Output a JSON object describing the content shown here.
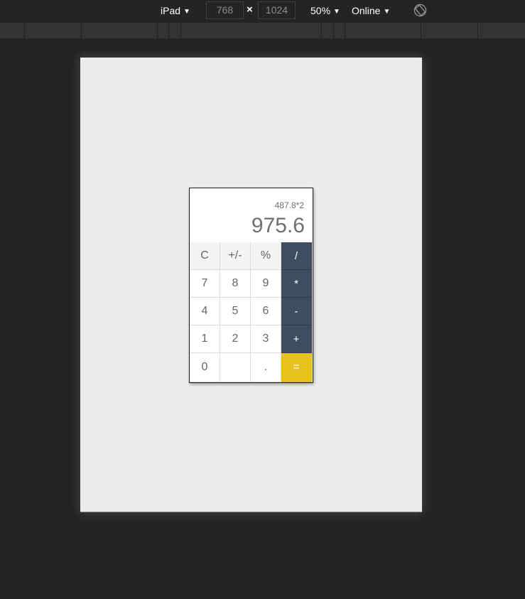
{
  "toolbar": {
    "device": "iPad",
    "width": "768",
    "height": "1024",
    "times": "×",
    "zoom": "50%",
    "network": "Online",
    "caret": "▼"
  },
  "calculator": {
    "expression": "487.8*2",
    "result": "975.6",
    "keys": [
      [
        "C",
        "+/-",
        "%",
        "/"
      ],
      [
        "7",
        "8",
        "9",
        "*"
      ],
      [
        "4",
        "5",
        "6",
        "-"
      ],
      [
        "1",
        "2",
        "3",
        "+"
      ],
      [
        "0",
        "",
        ".",
        "="
      ]
    ]
  },
  "colors": {
    "operator": "#3e4e60",
    "equals": "#e5c21e",
    "device_bg": "#ebecee",
    "chrome_bg": "#242424"
  }
}
